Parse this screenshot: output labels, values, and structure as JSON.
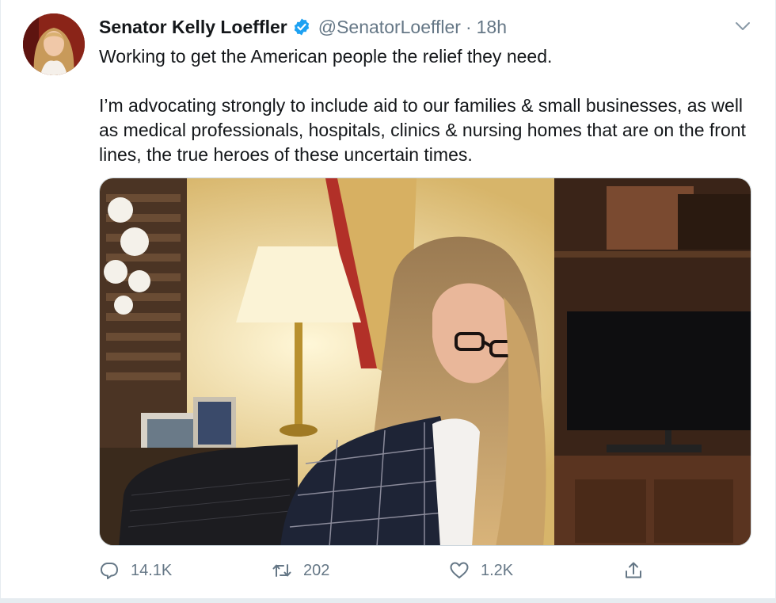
{
  "tweet": {
    "author": {
      "display_name": "Senator Kelly Loeffler",
      "handle": "@SenatorLoeffler",
      "verified": true
    },
    "separator": "·",
    "timestamp": "18h",
    "text": {
      "line1": "Working to get the American people the relief they need.",
      "line2": "I’m advocating strongly to include aid to our families & small businesses, as well as medical professionals, hospitals, clinics & nursing homes that are on the front lines, the true heroes of these uncertain times."
    },
    "actions": {
      "replies": "14.1K",
      "retweets": "202",
      "likes": "1.2K"
    }
  },
  "icons": {
    "verified": "verified-badge-icon",
    "more": "chevron-down-icon",
    "reply": "reply-bubble-icon",
    "retweet": "retweet-arrows-icon",
    "like": "heart-icon",
    "share": "share-upload-icon"
  },
  "colors": {
    "text": "#14171a",
    "secondary": "#657786",
    "verified": "#1da1f2",
    "border": "#e6ecf0"
  }
}
